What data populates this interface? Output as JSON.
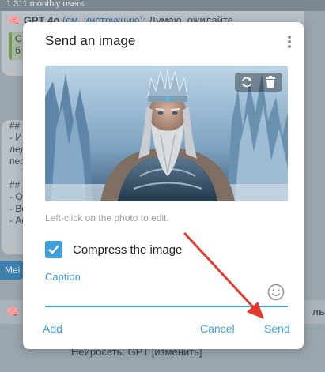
{
  "background": {
    "header_text": "1 311 monthly users",
    "message1_author": "GPT 4o",
    "message1_link": "(см. инструкцию)",
    "message1_text": ": Думаю, ожидайте",
    "message1_quote_lines": [
      "С",
      "б"
    ],
    "message2_lines": [
      "##",
      "- И",
      "лед",
      "пер",
      "",
      "##",
      "- О",
      "- Во",
      "- Ас"
    ],
    "menu_button": "Mei",
    "row_right_text": "ль",
    "bottom_text": "Нейросеть: GPT [изменить]"
  },
  "dialog": {
    "title": "Send an image",
    "hint": "Left-click on the photo to edit.",
    "compress_label": "Compress the image",
    "compress_checked": true,
    "caption_label": "Caption",
    "caption_value": "",
    "buttons": {
      "add": "Add",
      "cancel": "Cancel",
      "send": "Send"
    }
  },
  "colors": {
    "accent": "#3f9fd8",
    "annotation_arrow": "#e53a2f"
  },
  "icons": {
    "more": "more-vertical-icon",
    "rotate": "rotate-icon",
    "delete": "trash-icon",
    "emoji": "smiley-icon",
    "check": "checkmark-icon"
  }
}
